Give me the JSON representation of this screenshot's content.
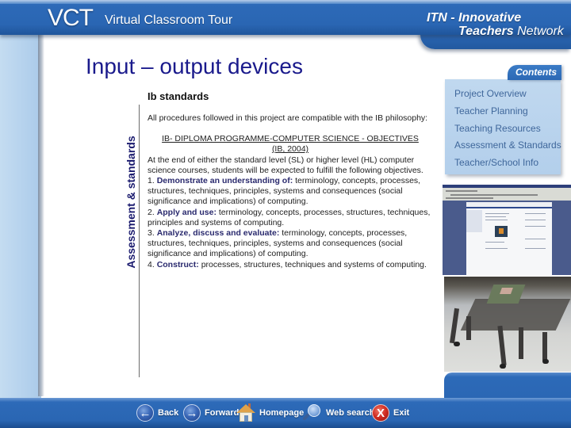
{
  "header": {
    "brand": "VCT",
    "subtitle": "Virtual Classroom Tour",
    "org_line1": "ITN - Innovative",
    "org_line2_bold": "Teachers",
    "org_line2_rest": " Network"
  },
  "page": {
    "title": "Input – output devices",
    "section_heading": "Ib standards",
    "vertical_label": "Assessment & standards"
  },
  "body": {
    "intro": "All procedures followed in this  project are compatible with the IB philosophy:",
    "link_line1": "IB- DIPLOMA PROGRAMME-COMPUTER SCIENCE - OBJECTIVES",
    "link_line2": "(IB, 2004)",
    "lead": "At the end of either the standard level (SL) or higher level (HL) computer science courses, students will be expected to fulfill the following objectives.",
    "objectives": [
      {
        "number": "1.",
        "title": "Demonstrate an understanding of:",
        "text": " terminology, concepts, processes, structures, techniques, principles, systems and consequences (social significance and implications) of computing."
      },
      {
        "number": "2.",
        "title": "Apply and use:",
        "text": " terminology, concepts, processes, structures, techniques, principles and systems of computing."
      },
      {
        "number": "3.",
        "title": "Analyze, discuss and evaluate:",
        "text": " terminology, concepts, processes, structures, techniques, principles, systems and consequences (social significance and implications) of computing."
      },
      {
        "number": "4.",
        "title": "Construct:",
        "text": " processes, structures, techniques and systems of computing."
      }
    ]
  },
  "contents": {
    "tab_label": "Contents",
    "items": [
      {
        "label": "Project Overview"
      },
      {
        "label": "Teacher Planning"
      },
      {
        "label": "Teaching  Resources"
      },
      {
        "label": "Assessment & Standards"
      },
      {
        "label": "Teacher/School Info"
      }
    ]
  },
  "images": {
    "browser_screenshot": "website-screenshot",
    "robot_photo": "robot-photo"
  },
  "nav": {
    "back": {
      "label": "Back",
      "icon": "arrow-left-icon"
    },
    "forward": {
      "label": "Forward",
      "icon": "arrow-right-icon"
    },
    "homepage": {
      "label": "Homepage",
      "icon": "house-icon"
    },
    "web_search": {
      "label": "Web search",
      "icon": "magnifier-icon"
    },
    "exit": {
      "label": "Exit",
      "icon": "x-icon",
      "icon_glyph": "X"
    }
  },
  "colors": {
    "banner_blue": "#2a66b3",
    "title_navy": "#1a1a8c",
    "panel_blue": "#b3cfeb",
    "contents_text": "#3f679b",
    "exit_red": "#d02a20"
  }
}
